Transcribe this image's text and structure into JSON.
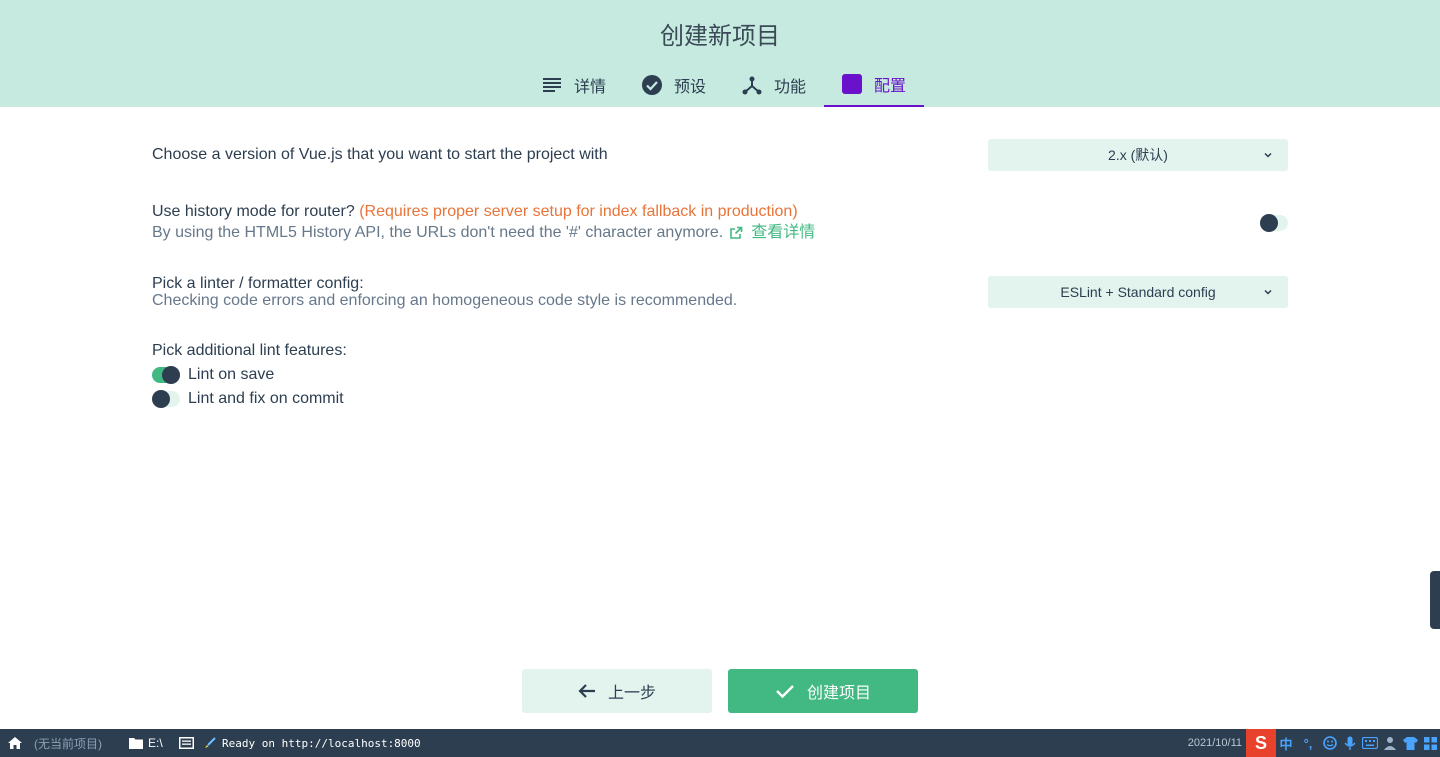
{
  "header": {
    "title": "创建新项目",
    "tabs": [
      {
        "label": "详情",
        "icon": "list-icon"
      },
      {
        "label": "预设",
        "icon": "check-circle-icon"
      },
      {
        "label": "功能",
        "icon": "fork-icon"
      },
      {
        "label": "配置",
        "icon": "settings-icon",
        "active": true
      }
    ]
  },
  "config": {
    "vue_version": {
      "label": "Choose a version of Vue.js that you want to start the project with",
      "selected": "2.x (默认)"
    },
    "history": {
      "label": "Use history mode for router?",
      "warning": "(Requires proper server setup for index fallback in production)",
      "description": "By using the HTML5 History API, the URLs don't need the '#' character anymore.",
      "link": "查看详情",
      "enabled": false
    },
    "linter": {
      "label": "Pick a linter / formatter config:",
      "description": "Checking code errors and enforcing an homogeneous code style is recommended.",
      "selected": "ESLint + Standard config"
    },
    "lint_features": {
      "label": "Pick additional lint features:",
      "options": [
        {
          "label": "Lint on save",
          "checked": true
        },
        {
          "label": "Lint and fix on commit",
          "checked": false
        }
      ]
    }
  },
  "buttons": {
    "prev": "上一步",
    "create": "创建项目"
  },
  "taskbar": {
    "project": "(无当前项目)",
    "folder": "E:\\",
    "status": "Ready on http://localhost:8000",
    "date": "2021/10/11",
    "ime_lang": "中",
    "ime_punct": "°,"
  },
  "colors": {
    "header_bg": "#c6eadf",
    "accent": "#42b983",
    "active_tab": "#6a11cb",
    "warning": "#e8743a",
    "dark": "#2c3e50"
  }
}
